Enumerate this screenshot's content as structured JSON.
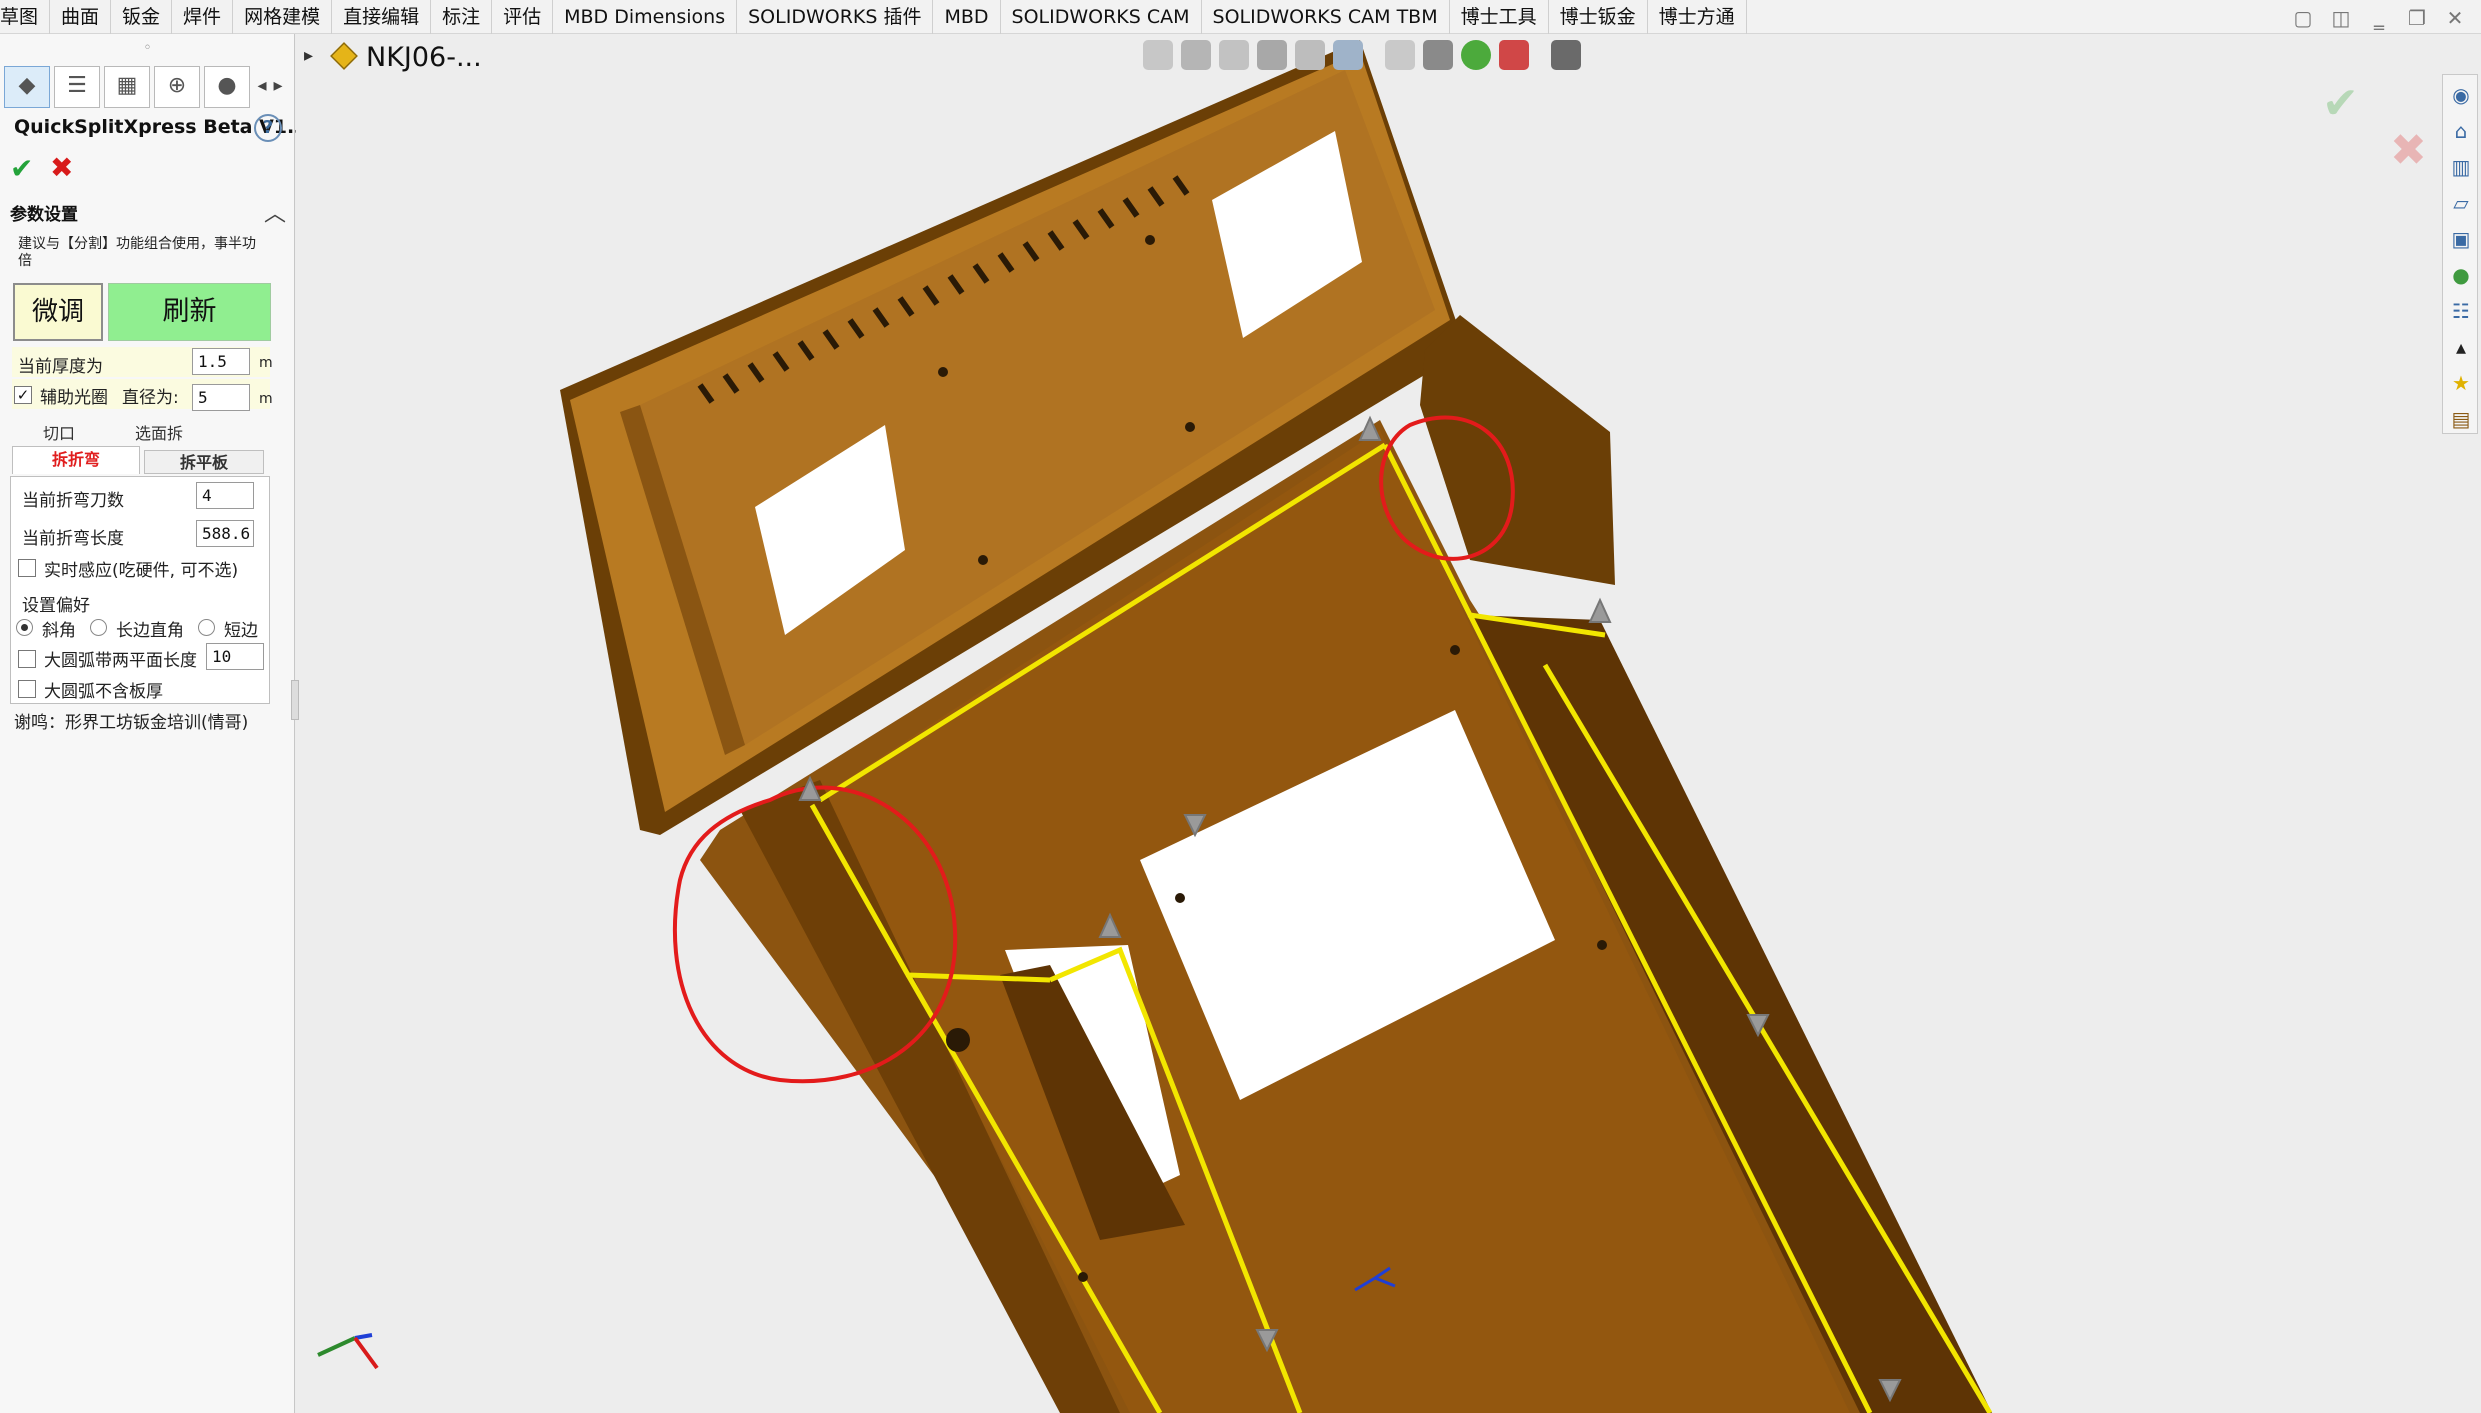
{
  "ribbon": {
    "tabs": [
      "草图",
      "曲面",
      "钣金",
      "焊件",
      "网格建模",
      "直接编辑",
      "标注",
      "评估",
      "MBD Dimensions",
      "SOLIDWORKS 插件",
      "MBD",
      "SOLIDWORKS CAM",
      "SOLIDWORKS CAM TBM",
      "博士工具",
      "博士钣金",
      "博士方通"
    ]
  },
  "window_buttons": [
    "restore-icon",
    "tile-icon",
    "minimize-icon",
    "maximize-icon",
    "close-icon"
  ],
  "panel": {
    "grip": "◦",
    "tools": [
      "part-icon",
      "feature-tree-icon",
      "property-icon",
      "crosshair-icon",
      "appearance-icon"
    ],
    "title": "QuickSplitXpress Beta V1.3",
    "help": "?",
    "ok": "✔",
    "cancel": "✖",
    "section": "参数设置",
    "note": "建议与【分割】功能组合使用，事半功倍",
    "fine_btn": "微调",
    "refresh_btn": "刷新",
    "thickness_label": "当前厚度为",
    "thickness_value": "1.5",
    "thickness_unit": "m",
    "aux_label": "辅助光圈",
    "aux_checked": true,
    "diameter_label": "直径为:",
    "diameter_value": "5",
    "diameter_unit": "m",
    "subtabs_top": [
      "切口",
      "选面拆"
    ],
    "subtabs_bottom": [
      "拆折弯",
      "拆平板"
    ],
    "bend_count_label": "当前折弯刀数",
    "bend_count_value": "4",
    "bend_length_label": "当前折弯长度",
    "bend_length_value": "588.6",
    "realtime_label": "实时感应(吃硬件, 可不选)",
    "prefs_label": "设置偏好",
    "prefs_options": [
      "斜角",
      "长边直角",
      "短边"
    ],
    "big_arc_label": "大圆弧带两平面长度",
    "big_arc_value": "10",
    "no_thickness_label": "大圆弧不含板厚",
    "thanks": "谢鸣：形界工坊钣金培训(情哥)"
  },
  "viewport": {
    "crumb": "NKJ06-...",
    "colors": {
      "sheet": "#b5761d",
      "sheet_dark": "#7a4a0c",
      "highlight": "#f2e600",
      "mark": "#e31b1b"
    }
  }
}
